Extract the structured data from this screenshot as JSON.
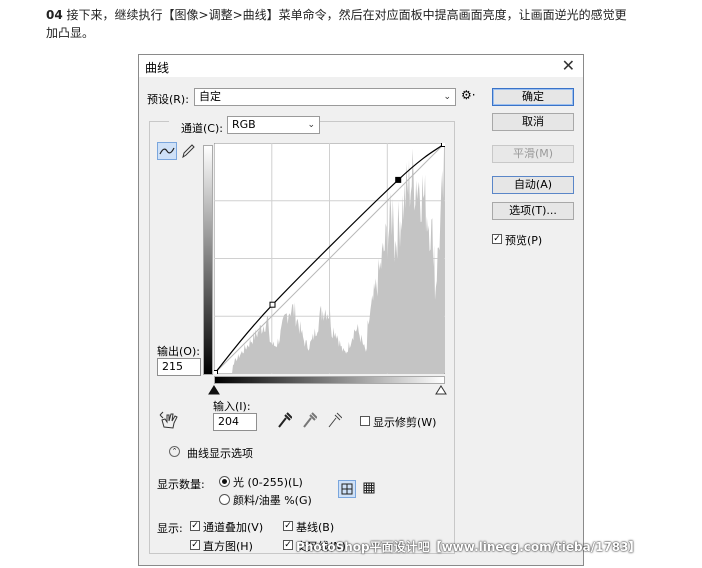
{
  "intro": {
    "step": "04",
    "line1": " 接下来，继续执行【图像>调整>曲线】菜单命令，然后在对应面板中提高画面亮度，让画面逆光的感觉更",
    "line2": "加凸显。"
  },
  "dialog": {
    "title": "曲线",
    "preset_label": "预设(R):",
    "preset_value": "自定",
    "channel_label": "通道(C):",
    "channel_value": "RGB",
    "buttons": {
      "ok": "确定",
      "cancel": "取消",
      "smooth": "平滑(M)",
      "auto": "自动(A)",
      "options": "选项(T)..."
    },
    "preview_label": "预览(P)",
    "preview_checked": true,
    "output_label": "输出(O):",
    "output_value": "215",
    "input_label": "输入(I):",
    "input_value": "204",
    "show_clipping_label": "显示修剪(W)",
    "show_clipping_checked": false,
    "display_options_label": "曲线显示选项",
    "show_amount_label": "显示数量:",
    "light_option": "光 (0-255)(L)",
    "pigment_option": "颜料/油墨 %(G)",
    "light_selected": true,
    "show_label": "显示:",
    "checkboxes": [
      {
        "label": "通道叠加(V)",
        "checked": true
      },
      {
        "label": "基线(B)",
        "checked": true
      },
      {
        "label": "直方图(H)",
        "checked": true
      },
      {
        "label": "交叉线(N)",
        "checked": true
      }
    ]
  },
  "curve": {
    "points": [
      [
        0,
        0
      ],
      [
        64,
        76
      ],
      [
        204,
        215
      ],
      [
        255,
        255
      ]
    ]
  },
  "colors": {
    "default_button_border": "#3a73c8",
    "histogram": "#c4c4c4",
    "curve": "#000000",
    "grid": "#d0d0d0"
  },
  "watermark": "PhotoShop平面设计吧【www.linecg.com/tieba/1783】"
}
